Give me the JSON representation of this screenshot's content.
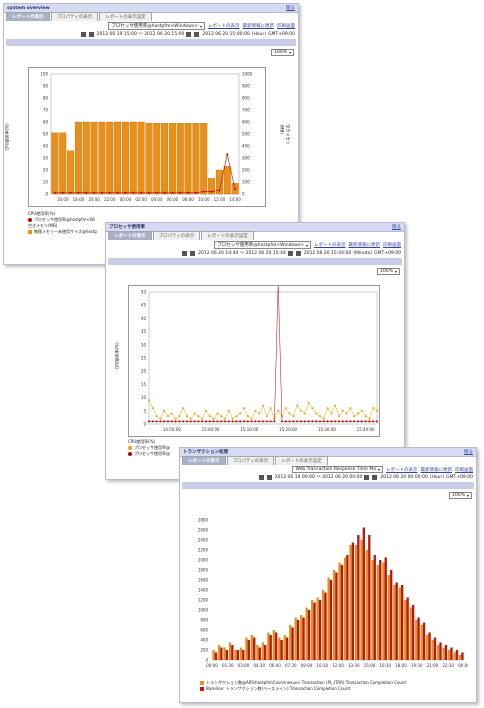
{
  "w1": {
    "title": "system overview",
    "close": "閉る",
    "tab_active": "レポートの表示",
    "tab2": "プロパティの表示",
    "tab3": "レポートの表示設定",
    "select": "プロセッサ使用率@hostpfm<Windows>",
    "actions": [
      "レポートの表示",
      "最新情報に更新",
      "印刷画面"
    ],
    "date": "2012 06 20 15:00:00",
    "interval": "(Hour)",
    "tz": "GMT+09:00",
    "range": "2012 06 19 15:00 〜 2012 06 20 15:00",
    "zoom": "100%",
    "legend_title": "CPU使用率(%)",
    "legend1": "プロセッサ使用率@hostpfm<Wi",
    "legend_title2": "空きメモリ(MB)",
    "legend2": "物理メモリー未使用サイズ@hostp",
    "ylabel_left": "CPU使用率(%)",
    "ylabel_right": "空きメモリ(MB)"
  },
  "w2": {
    "title": "プロセッサ使用率",
    "close": "閉る",
    "tab_active": "レポートの表示",
    "tab2": "プロパティの表示",
    "tab3": "レポートの表示設定",
    "select": "プロセッサ使用率@hostpfm<Windows>",
    "actions": [
      "レポートの表示",
      "最新情報に更新",
      "印刷画面"
    ],
    "date": "2012 06 20 15:44:00",
    "interval": "(Minute)",
    "tz": "GMT+09:00",
    "range": "2012 06 20 14:44 〜 2012 06 20 15:44",
    "zoom": "100%",
    "legend_title": "CPU使用率(%)",
    "legend1": "プロセッサ使用率@",
    "legend2": "プロセッサ使用率@",
    "ylabel": "CPU使用率(%)"
  },
  "w3": {
    "title": "トランザクション処理",
    "close": "閉る",
    "tab_active": "レポートの表示",
    "tab2": "プロパティの表示",
    "tab3": "レポートの表示設定",
    "select": "Web Transaction Response Time Ma",
    "actions": [
      "レポートの表示",
      "最新情報に更新",
      "印刷画面"
    ],
    "date": "2012 06 20 00:00:00",
    "interval": "(Hour)",
    "tz": "GMT+09:00",
    "range": "2012 06 19 00:00 〜 2012 06 20 00:00",
    "zoom": "100%",
    "legend1": "トランザクション数@APS\\hostpfm\\Cosminexus< Transaction (PL_ITAR):Transaction Completion Count",
    "legend2": "Baseline: トランザクション数(ベースライン):Transaction Completion Count"
  },
  "chart_data": [
    {
      "type": "bar",
      "colors": {
        "bar": "#e8901a",
        "line": "#c00000"
      },
      "categories": [
        "15:00",
        "16:00",
        "17:00",
        "18:00",
        "19:00",
        "20:00",
        "21:00",
        "22:00",
        "23:00",
        "00:00",
        "01:00",
        "02:00",
        "03:00",
        "04:00",
        "05:00",
        "06:00",
        "07:00",
        "08:00",
        "09:00",
        "10:00",
        "11:00",
        "12:00",
        "13:00",
        "14:00"
      ],
      "x_tick_labels": [
        "16:00",
        "18:00",
        "20:00",
        "22:00",
        "00:00",
        "02:00",
        "04:00",
        "06:00",
        "08:00",
        "10:00",
        "12:00",
        "14:00"
      ],
      "y_left_ticks": [
        "0",
        "10",
        "20",
        "30",
        "40",
        "50",
        "60",
        "70",
        "80",
        "90",
        "100"
      ],
      "y_right_ticks": [
        "0",
        "100",
        "200",
        "300",
        "400",
        "500",
        "600",
        "700",
        "800",
        "900",
        "1000"
      ],
      "series": [
        {
          "name": "物理メモリー未使用サイズ@hostp",
          "values": [
            510,
            510,
            360,
            600,
            600,
            600,
            600,
            600,
            600,
            600,
            600,
            600,
            590,
            590,
            590,
            590,
            590,
            590,
            590,
            590,
            130,
            200,
            230,
            90
          ]
        },
        {
          "name": "プロセッサ使用率@hostpfm<Wi",
          "values": [
            1,
            1,
            1,
            1,
            1,
            1,
            1,
            1,
            1,
            1,
            1,
            1,
            1,
            1,
            1,
            1,
            1,
            1,
            1,
            2,
            2,
            3,
            33,
            4
          ]
        }
      ],
      "ylim_left": [
        0,
        100
      ],
      "ylim_right": [
        0,
        1000
      ]
    },
    {
      "type": "line",
      "colors": {
        "s1": "#f5a000",
        "s2": "#c00000"
      },
      "x_tick_labels": [
        "14:50:00",
        "15:00:00",
        "15:10:00",
        "15:20:00",
        "15:30:00",
        "15:40:00"
      ],
      "y_ticks": [
        "0",
        "5",
        "10",
        "15",
        "20",
        "25",
        "30",
        "35",
        "40",
        "45",
        "50"
      ],
      "ylim": [
        0,
        50
      ],
      "series": [
        {
          "name": "プロセッサ使用率@",
          "values": [
            9,
            6,
            3,
            2,
            5,
            3,
            4,
            2,
            3,
            6,
            3,
            2,
            4,
            3,
            2,
            5,
            3,
            2,
            4,
            3,
            2,
            5,
            2,
            3,
            4,
            6,
            3,
            2,
            5,
            4,
            7,
            3,
            6,
            2,
            5,
            3,
            6,
            4,
            3,
            7,
            5,
            4,
            8,
            6,
            4,
            3,
            2,
            6,
            4,
            7,
            3,
            5,
            4,
            6,
            3,
            4,
            5,
            3,
            2,
            6,
            5
          ]
        },
        {
          "name": "プロセッサ使用率@",
          "values": [
            1,
            1,
            1,
            1,
            1,
            1,
            1,
            1,
            1,
            1,
            1,
            1,
            1,
            1,
            1,
            1,
            1,
            1,
            1,
            1,
            1,
            1,
            1,
            1,
            1,
            1,
            1,
            1,
            1,
            1,
            1,
            1,
            1,
            1,
            54,
            1,
            1,
            1,
            1,
            1,
            1,
            1,
            1,
            1,
            1,
            1,
            1,
            1,
            1,
            1,
            1,
            1,
            1,
            1,
            1,
            1,
            1,
            1,
            1,
            1,
            1
          ]
        }
      ]
    },
    {
      "type": "bar",
      "colors": {
        "a": "#e8901a",
        "b": "#b81818"
      },
      "categories": [
        "00:00",
        "00:30",
        "01:00",
        "01:30",
        "02:00",
        "02:30",
        "03:00",
        "03:30",
        "04:00",
        "04:30",
        "05:00",
        "05:30",
        "06:00",
        "06:30",
        "07:00",
        "07:30",
        "08:00",
        "08:30",
        "09:00",
        "09:30",
        "10:00",
        "10:30",
        "11:00",
        "11:30",
        "12:00",
        "12:30",
        "13:00",
        "13:30",
        "14:00",
        "14:30",
        "15:00",
        "15:30",
        "16:00",
        "16:30",
        "17:00",
        "17:30",
        "18:00",
        "18:30",
        "19:00",
        "19:30",
        "20:00",
        "20:30",
        "21:00",
        "21:30",
        "22:00",
        "22:30"
      ],
      "x_tick_labels": [
        "00:00",
        "01:30",
        "03:00",
        "04:30",
        "06:00",
        "07:30",
        "09:00",
        "10:30",
        "12:00",
        "13:30",
        "15:00",
        "16:30",
        "18:00",
        "19:30",
        "21:00",
        "22:30",
        "00:00"
      ],
      "y_ticks": [
        "0",
        "200",
        "400",
        "600",
        "800",
        "1000",
        "1200",
        "1400",
        "1600",
        "1800",
        "2000",
        "2200",
        "2400",
        "2600",
        "2800"
      ],
      "ylim": [
        0,
        2800
      ],
      "series": [
        {
          "name": "トランザクション数@APS\\hostpfm\\Cosminexus< Transaction (PL_ITAR):Transaction Completion Count",
          "values": [
            200,
            300,
            250,
            350,
            200,
            250,
            450,
            500,
            300,
            350,
            550,
            600,
            450,
            500,
            700,
            850,
            900,
            1050,
            1200,
            1250,
            1400,
            1650,
            1800,
            1950,
            2050,
            2300,
            2300,
            2400,
            2200,
            2000,
            1900,
            1950,
            1700,
            1500,
            1450,
            1200,
            1050,
            800,
            700,
            500,
            400,
            300,
            250,
            200,
            150,
            100
          ]
        },
        {
          "name": "Baseline: トランザクション数(ベースライン):Transaction Completion Count",
          "values": [
            150,
            250,
            200,
            300,
            200,
            200,
            400,
            450,
            250,
            300,
            500,
            550,
            400,
            450,
            650,
            800,
            850,
            1000,
            1150,
            1200,
            1350,
            1600,
            1750,
            1900,
            2100,
            2350,
            2500,
            2650,
            2500,
            2100,
            2000,
            2050,
            1800,
            1550,
            1500,
            1250,
            1100,
            850,
            750,
            550,
            450,
            350,
            300,
            250,
            200,
            150
          ]
        }
      ]
    }
  ]
}
